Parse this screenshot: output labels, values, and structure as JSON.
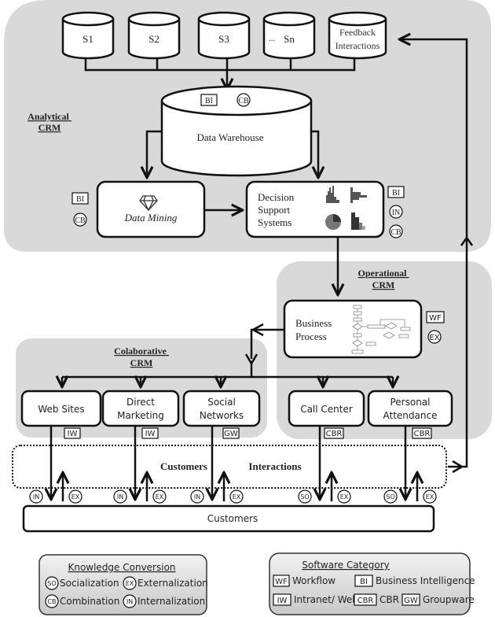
{
  "sections": {
    "analytical": [
      "Analytical",
      "CRM"
    ],
    "operational": [
      "Operational",
      "CRM"
    ],
    "collaborative": [
      "Colaborative",
      "CRM"
    ]
  },
  "sources": [
    "S1",
    "S2",
    "S3",
    "Sn"
  ],
  "ellipsis": "...",
  "feedback": [
    "Feedback",
    "Interactions"
  ],
  "warehouse": {
    "label": "Data Warehouse",
    "badges": [
      "BI",
      "CB"
    ]
  },
  "data_mining": {
    "label": "Data Mining",
    "badges": [
      "BI",
      "CB"
    ]
  },
  "dss": {
    "lines": [
      "Decision",
      "Support",
      "Systems"
    ],
    "badges": [
      "BI",
      "IN",
      "CB"
    ]
  },
  "business_process": {
    "lines": [
      "Business",
      "Process"
    ],
    "badges": [
      "WF",
      "EX"
    ]
  },
  "channels": [
    {
      "lines": [
        "Web Sites"
      ],
      "software": "IW",
      "down": "IN",
      "up": "EX"
    },
    {
      "lines": [
        "Direct",
        "Marketing"
      ],
      "software": "IW",
      "down": "IN",
      "up": "EX"
    },
    {
      "lines": [
        "Social",
        "Networks"
      ],
      "software": "GW",
      "down": "IN",
      "up": "EX"
    },
    {
      "lines": [
        "Call Center"
      ],
      "software": "CBR",
      "down": "SO",
      "up": "EX"
    },
    {
      "lines": [
        "Personal",
        "Attendance"
      ],
      "software": "CBR",
      "down": "SO",
      "up": "EX"
    }
  ],
  "interactions": {
    "left": "Customers",
    "right": "Interactions"
  },
  "customers": "Customers",
  "legend_knowledge": {
    "title": "Knowledge Conversion",
    "items": [
      {
        "code": "SO",
        "label": "Socialization"
      },
      {
        "code": "EX",
        "label": "Externalization"
      },
      {
        "code": "CB",
        "label": "Combination"
      },
      {
        "code": "IN",
        "label": "Internalization"
      }
    ]
  },
  "legend_software": {
    "title": "Software Category",
    "items": [
      {
        "code": "WF",
        "label": "Workflow"
      },
      {
        "code": "BI",
        "label": "Business Intelligence"
      },
      {
        "code": "IW",
        "label": "Intranet/ Web"
      },
      {
        "code": "CBR",
        "label": "CBR"
      },
      {
        "code": "GW",
        "label": "Groupware"
      }
    ]
  },
  "colors": {
    "region": "#d9d9d9",
    "line": "#111111",
    "box": "#ffffff"
  }
}
